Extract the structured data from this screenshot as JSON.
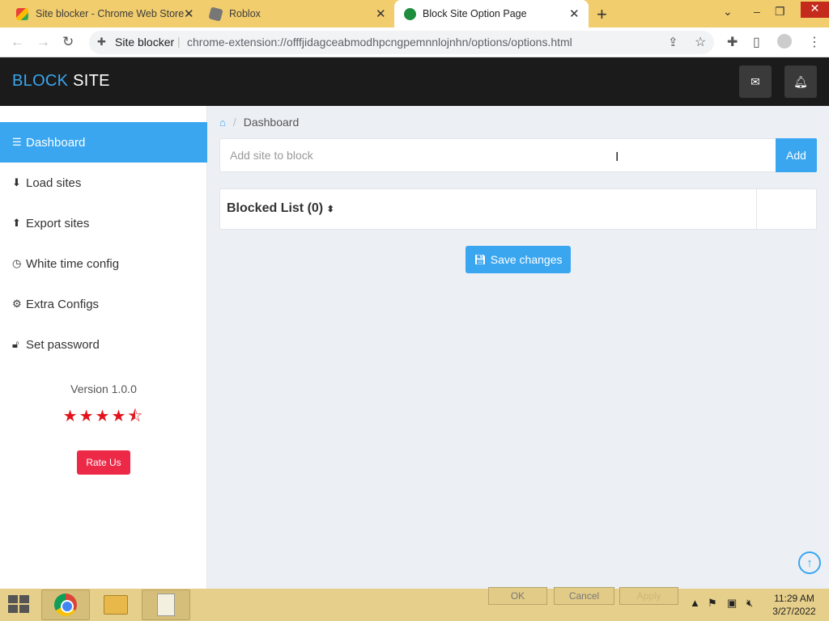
{
  "browser": {
    "tabs": [
      {
        "title": "Site blocker - Chrome Web Store",
        "active": false
      },
      {
        "title": "Roblox",
        "active": false
      },
      {
        "title": "Block Site Option Page",
        "active": true
      }
    ],
    "site_chip": "Site blocker",
    "url": "chrome-extension://offfjidagceabmodhpcngpemnnlojnhn/options/options.html"
  },
  "header": {
    "logo_part1": "BLOCK",
    "logo_part2": "SITE"
  },
  "sidebar": {
    "items": [
      {
        "label": "Dashboard",
        "icon": "list-icon",
        "active": true
      },
      {
        "label": "Load sites",
        "icon": "download-icon",
        "active": false
      },
      {
        "label": "Export sites",
        "icon": "upload-icon",
        "active": false
      },
      {
        "label": "White time config",
        "icon": "clock-icon",
        "active": false
      },
      {
        "label": "Extra Configs",
        "icon": "gear-icon",
        "active": false
      },
      {
        "label": "Set password",
        "icon": "lock-icon",
        "active": false
      }
    ],
    "version": "Version 1.0.0",
    "rating": 4.5,
    "rate_label": "Rate Us"
  },
  "main": {
    "breadcrumb": "Dashboard",
    "input_placeholder": "Add site to block",
    "add_label": "Add",
    "blocked_list_title": "Blocked List (0)",
    "save_label": "Save changes"
  },
  "taskbar": {
    "dialog_buttons": [
      "OK",
      "Cancel",
      "Apply"
    ],
    "time": "11:29 AM",
    "date": "3/27/2022"
  },
  "colors": {
    "accent": "#3aa6f0",
    "header_bg": "#1b1b1b",
    "rate_button": "#ec2a48",
    "stars": "#e2131c",
    "tab_strip": "#f2cd6e",
    "taskbar": "#e6cf8a"
  }
}
